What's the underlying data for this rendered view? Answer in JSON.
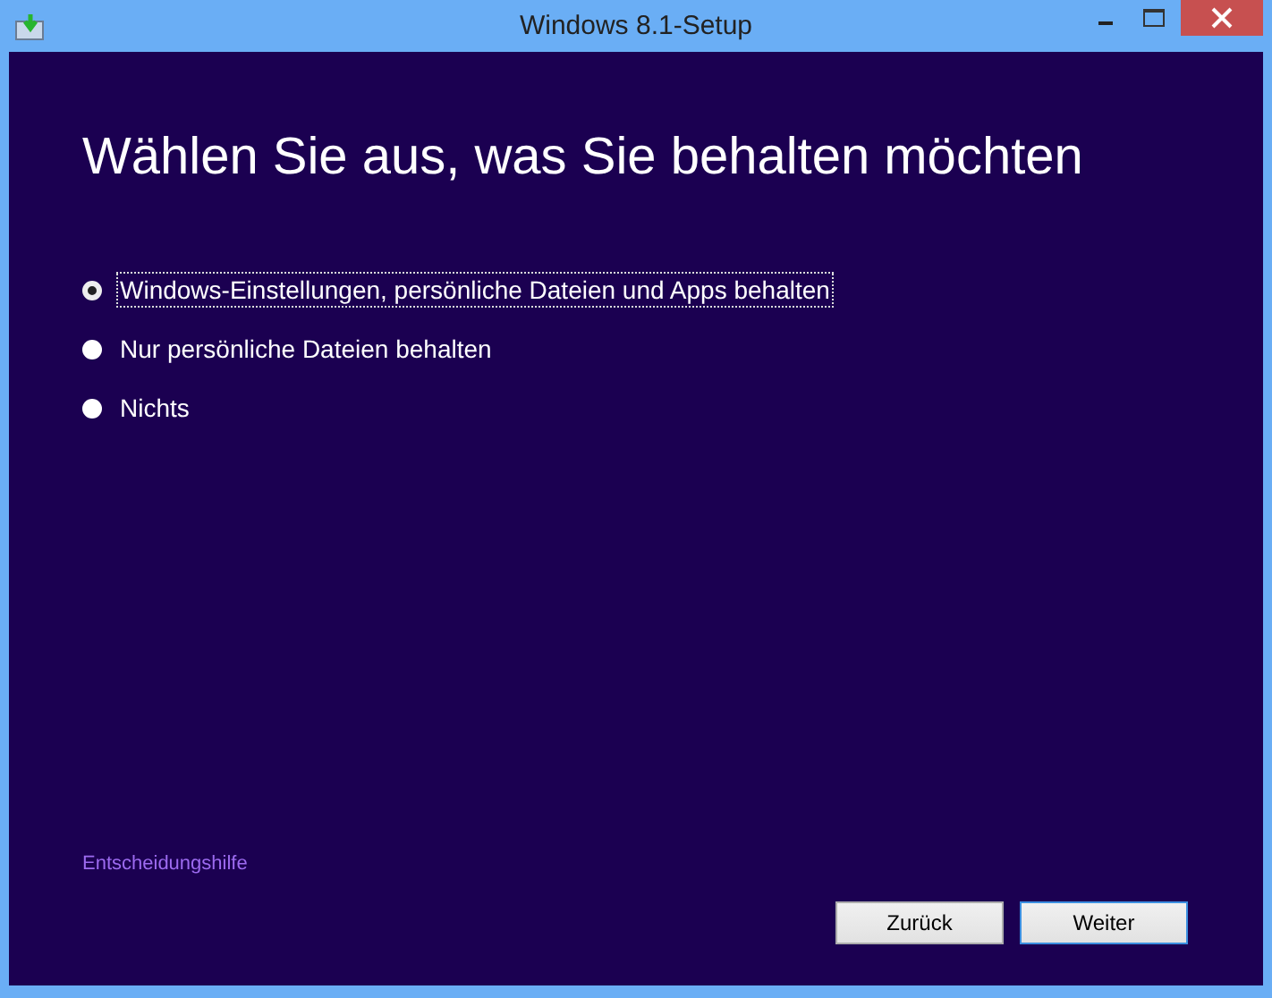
{
  "window": {
    "title": "Windows 8.1-Setup"
  },
  "heading": "Wählen Sie aus, was Sie behalten möchten",
  "options": [
    {
      "label": "Windows-Einstellungen, persönliche Dateien und Apps behalten",
      "selected": true
    },
    {
      "label": "Nur persönliche Dateien behalten",
      "selected": false
    },
    {
      "label": "Nichts",
      "selected": false
    }
  ],
  "help_link": "Entscheidungshilfe",
  "buttons": [
    {
      "label": "Zurück",
      "default": false
    },
    {
      "label": "Weiter",
      "default": true
    }
  ]
}
